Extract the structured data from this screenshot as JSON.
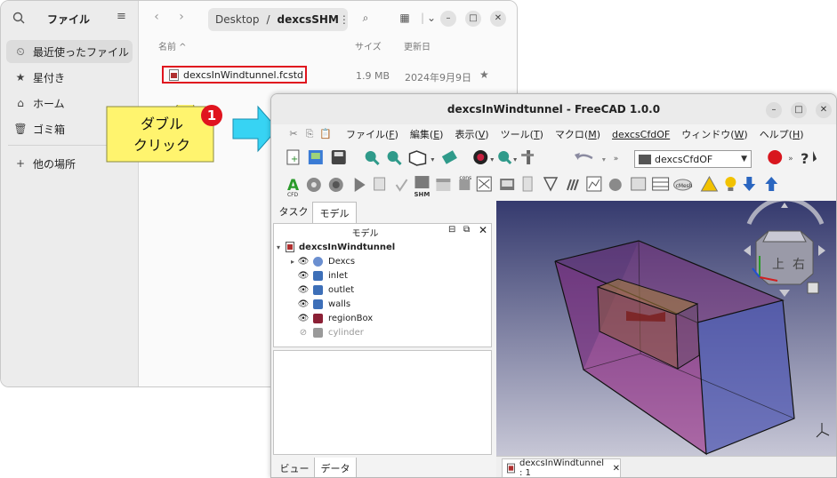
{
  "file_manager": {
    "title": "ファイル",
    "sidebar": [
      {
        "label": "最近使ったファイル",
        "icon": "clock-icon"
      },
      {
        "label": "星付き",
        "icon": "star-icon"
      },
      {
        "label": "ホーム",
        "icon": "home-icon"
      },
      {
        "label": "ゴミ箱",
        "icon": "trash-icon"
      },
      {
        "label": "他の場所",
        "icon": "plus-icon"
      }
    ],
    "path": [
      "Desktop",
      "dexcsSHM"
    ],
    "columns": {
      "name": "名前 ^",
      "size": "サイズ",
      "modified": "更新日"
    },
    "file": {
      "name": "dexcsInWindtunnel.fcstd",
      "size": "1.9 MB",
      "date": "2024年9月9日"
    }
  },
  "annotation": {
    "lines": [
      "ダブル",
      "クリック"
    ],
    "badge": "1"
  },
  "freecad": {
    "title": "dexcsInWindtunnel - FreeCAD 1.0.0",
    "menu": [
      {
        "label": "ファイル(",
        "key": "F",
        "end": ")"
      },
      {
        "label": "編集(",
        "key": "E",
        "end": ")"
      },
      {
        "label": "表示(",
        "key": "V",
        "end": ")"
      },
      {
        "label": "ツール(",
        "key": "T",
        "end": ")"
      },
      {
        "label": "マクロ(",
        "key": "M",
        "end": ")"
      },
      {
        "label": "dexcsCfdOF",
        "key": "",
        "end": ""
      },
      {
        "label": "ウィンドウ(",
        "key": "W",
        "end": ")"
      },
      {
        "label": "ヘルプ(",
        "key": "H",
        "end": ")"
      }
    ],
    "workbench": "dexcsCfdOF",
    "tabs_top": [
      "タスク",
      "モデル"
    ],
    "tree_header": "モデル",
    "tree": [
      {
        "label": "dexcsInWindtunnel",
        "color": "#3c3c3c",
        "bold": true
      },
      {
        "label": "Dexcs",
        "color": "#6b8fd0"
      },
      {
        "label": "inlet",
        "color": "#3d6fb8"
      },
      {
        "label": "outlet",
        "color": "#3d6fb8"
      },
      {
        "label": "walls",
        "color": "#3d6fb8"
      },
      {
        "label": "regionBox",
        "color": "#8b2035"
      },
      {
        "label": "cylinder",
        "color": "#9a9a9a",
        "dim": true
      }
    ],
    "tabs_bottom": [
      "ビュー",
      "データ"
    ],
    "doc_tab": "dexcsInWindtunnel : 1",
    "navcube_faces": [
      "上",
      "右"
    ]
  }
}
